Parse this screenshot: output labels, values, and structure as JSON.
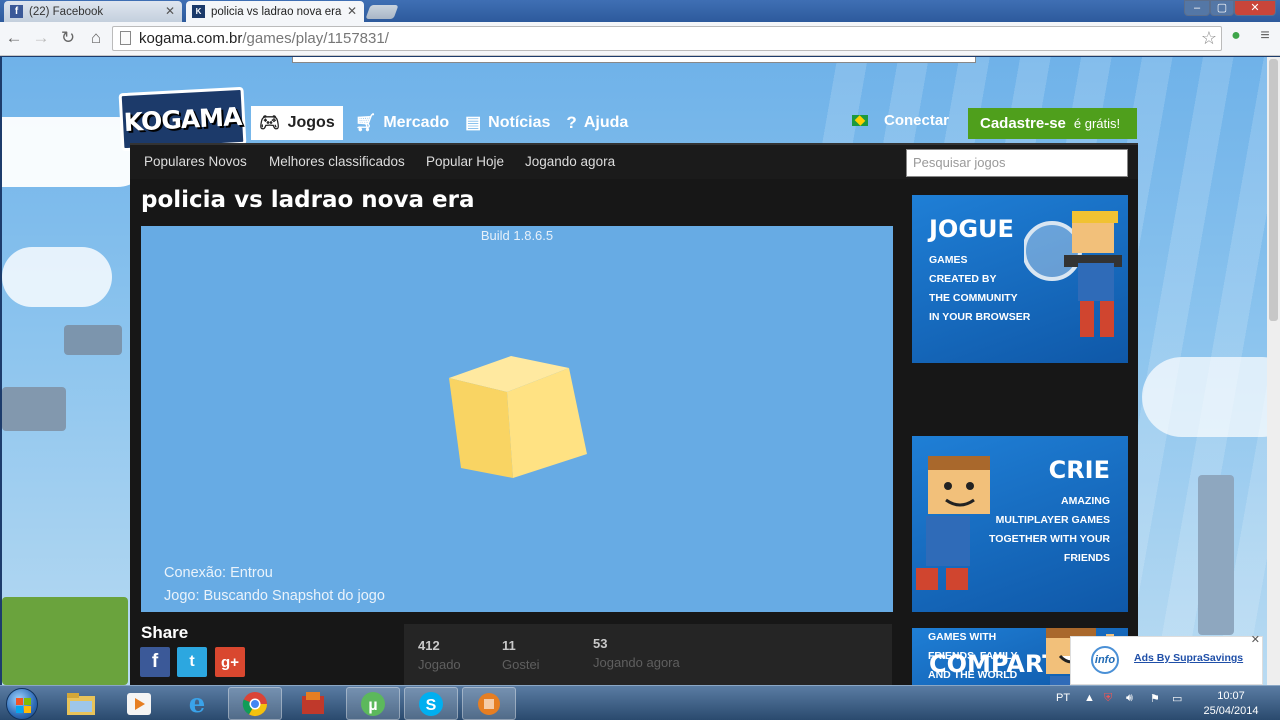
{
  "browser": {
    "tabs": [
      {
        "title": "(22) Facebook",
        "active": false
      },
      {
        "title": "policia vs ladrao nova era",
        "active": true
      }
    ],
    "url_host": "kogama.com.br",
    "url_path": "/games/play/1157831/"
  },
  "site": {
    "logo": "KOGAMA",
    "nav": [
      {
        "label": "Jogos",
        "icon": "gamepad-icon"
      },
      {
        "label": "Mercado",
        "icon": "cart-icon"
      },
      {
        "label": "Notícias",
        "icon": "news-icon"
      },
      {
        "label": "Ajuda",
        "icon": "help-icon"
      }
    ],
    "connect": "Conectar",
    "signup": "Cadastre-se",
    "signup_free": "é grátis!",
    "subnav": [
      "Populares Novos",
      "Melhores classificados",
      "Popular Hoje",
      "Jogando agora"
    ],
    "search_placeholder": "Pesquisar jogos"
  },
  "game": {
    "title": "policia vs ladrao nova era",
    "build": "Build 1.8.6.5",
    "status_connection": "Conexão: Entrou",
    "status_game": "Jogo: Buscando Snapshot do jogo",
    "share_label": "Share",
    "stats": [
      {
        "value": "412",
        "label": "Jogado"
      },
      {
        "value": "11",
        "label": "Gostei"
      },
      {
        "value": "53",
        "label": "Jogando agora"
      }
    ]
  },
  "promos": [
    {
      "heading": "JOGUE",
      "lines": [
        "GAMES",
        "CREATED BY",
        "THE COMMUNITY",
        "IN YOUR BROWSER"
      ]
    },
    {
      "heading": "CRIE",
      "lines": [
        "AMAZING",
        "MULTIPLAYER GAMES",
        "TOGETHER WITH YOUR",
        "FRIENDS"
      ]
    },
    {
      "heading": "COMPART",
      "lines": [
        "GAMES WITH",
        "FRIENDS, FAMILY,",
        "AND THE WORLD"
      ]
    }
  ],
  "ads": {
    "icon_text": "info",
    "label": "Ads By SupraSavings"
  },
  "taskbar": {
    "lang": "PT",
    "time": "10:07",
    "date": "25/04/2014"
  },
  "colors": {
    "signup_green": "#4f9f1c",
    "viewport_blue": "#67abe4",
    "promo_blue": "#1f7fd6"
  }
}
